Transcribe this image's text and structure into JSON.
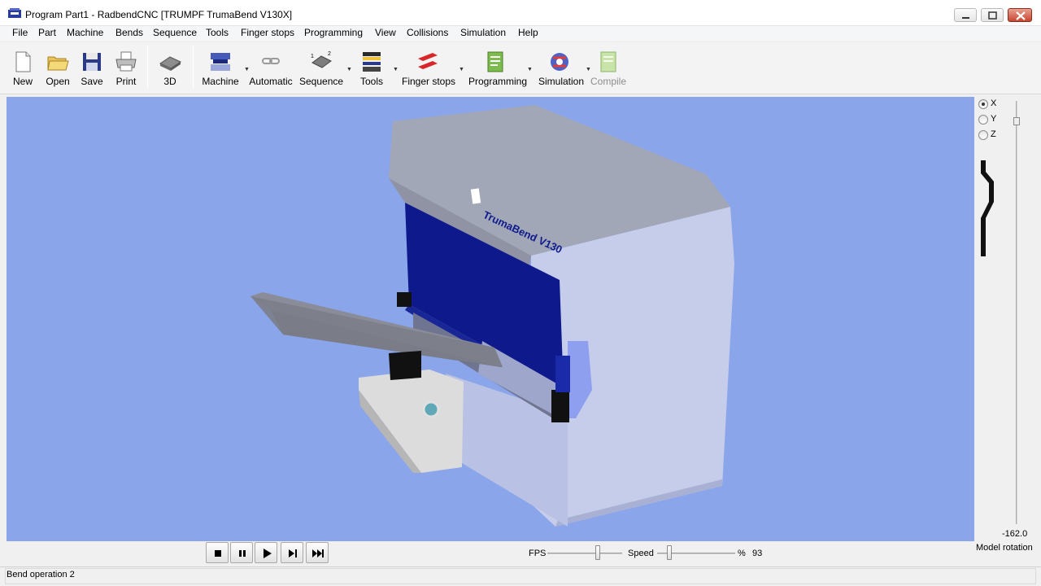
{
  "window": {
    "title": "Program Part1 - RadbendCNC [TRUMPF TrumaBend V130X]"
  },
  "menu": [
    "File",
    "Part",
    "Machine",
    "Bends",
    "Sequence",
    "Tools",
    "Finger stops",
    "Programming",
    "View",
    "Collisions",
    "Simulation",
    "Help"
  ],
  "toolbar": {
    "new": "New",
    "open": "Open",
    "save": "Save",
    "print": "Print",
    "threed": "3D",
    "machine": "Machine",
    "automatic": "Automatic",
    "sequence": "Sequence",
    "tools": "Tools",
    "finger_stops": "Finger stops",
    "programming": "Programming",
    "simulation": "Simulation",
    "compile": "Compile"
  },
  "viewport": {
    "background": "#8ba5ea",
    "machine_brand_text": "TrumaBend V130"
  },
  "axis_selector": {
    "options": [
      "X",
      "Y",
      "Z"
    ],
    "selected": "X"
  },
  "model_rotation": {
    "value": "-162.0",
    "label": "Model rotation"
  },
  "playback": {
    "fps_label": "FPS",
    "speed_label": "Speed",
    "percent_label": "%",
    "speed_value": "93"
  },
  "status": {
    "text": "Bend operation 2"
  },
  "colors": {
    "accent_blue": "#0e1a8c",
    "machine_body": "#c7cfea",
    "close_red": "#c84531"
  }
}
